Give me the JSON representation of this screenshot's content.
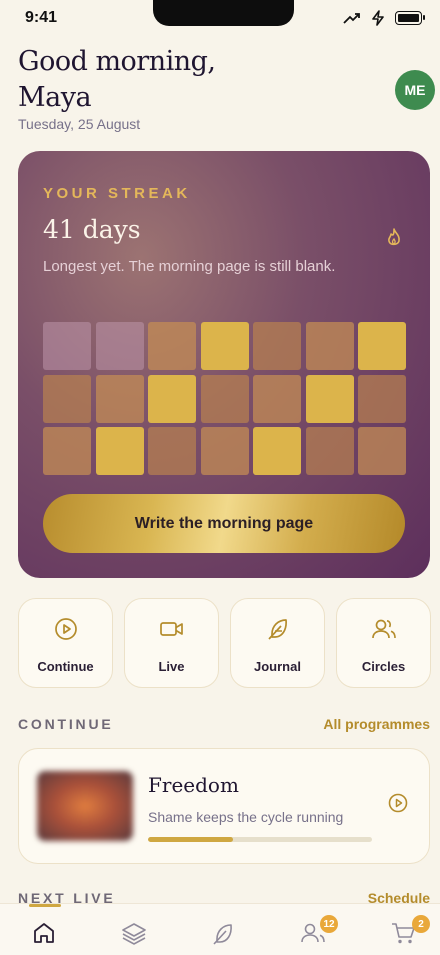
{
  "status_bar": {
    "time": "9:41"
  },
  "header": {
    "greeting": "Good morning, Maya",
    "date": "Tuesday, 25 August",
    "avatar_initials": "ME"
  },
  "streak": {
    "label": "YOUR STREAK",
    "days": "41 days",
    "subtitle": "Longest yet. The morning page is still blank.",
    "cta": "Write the morning page",
    "grid": [
      [
        "faint",
        "faint",
        "mid",
        "gold",
        "mid",
        "mid",
        "gold"
      ],
      [
        "mid",
        "mid",
        "gold",
        "mid",
        "mid",
        "gold",
        "mid"
      ],
      [
        "mid",
        "gold",
        "mid",
        "mid",
        "gold",
        "mid",
        "mid"
      ]
    ]
  },
  "quick_actions": [
    {
      "label": "Continue",
      "icon": "play-circle-icon"
    },
    {
      "label": "Live",
      "icon": "video-camera-icon"
    },
    {
      "label": "Journal",
      "icon": "feather-icon"
    },
    {
      "label": "Circles",
      "icon": "users-icon"
    }
  ],
  "continue_section": {
    "title": "CONTINUE",
    "link": "All programmes",
    "item": {
      "title": "Freedom",
      "subtitle": "Shame keeps the cycle running",
      "progress": 0.38
    }
  },
  "next_live_section": {
    "title": "NEXT LIVE",
    "link": "Schedule"
  },
  "tabbar": {
    "items": [
      {
        "name": "home-icon",
        "active": true
      },
      {
        "name": "layers-icon"
      },
      {
        "name": "feather-icon"
      },
      {
        "name": "users-icon",
        "badge": "12"
      },
      {
        "name": "cart-icon",
        "badge": "2"
      }
    ]
  },
  "colors": {
    "accent_gold": "#cfa741",
    "card_purple": "#5d2f5c",
    "avatar_green": "#3e8b4f",
    "badge_orange": "#e9a83a"
  }
}
